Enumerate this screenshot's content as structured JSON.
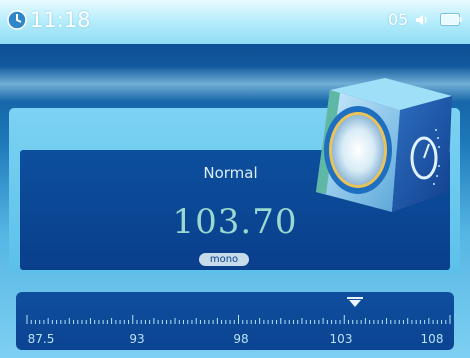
{
  "status_bar": {
    "time": "11:18",
    "volume": "05",
    "icons": [
      "clock-icon",
      "speaker-icon",
      "battery-icon"
    ]
  },
  "radio": {
    "mode": "Normal",
    "frequency": "103.70",
    "stereo_mode": "mono"
  },
  "scale": {
    "labels": [
      "87.5",
      "93",
      "98",
      "103",
      "108"
    ],
    "min": 87.5,
    "max": 108,
    "pointer_value": 103.7
  },
  "colors": {
    "status_bar": "#b9eefc",
    "panel_dark": "#0c4f9d",
    "frequency_text": "#9ad8d0"
  }
}
